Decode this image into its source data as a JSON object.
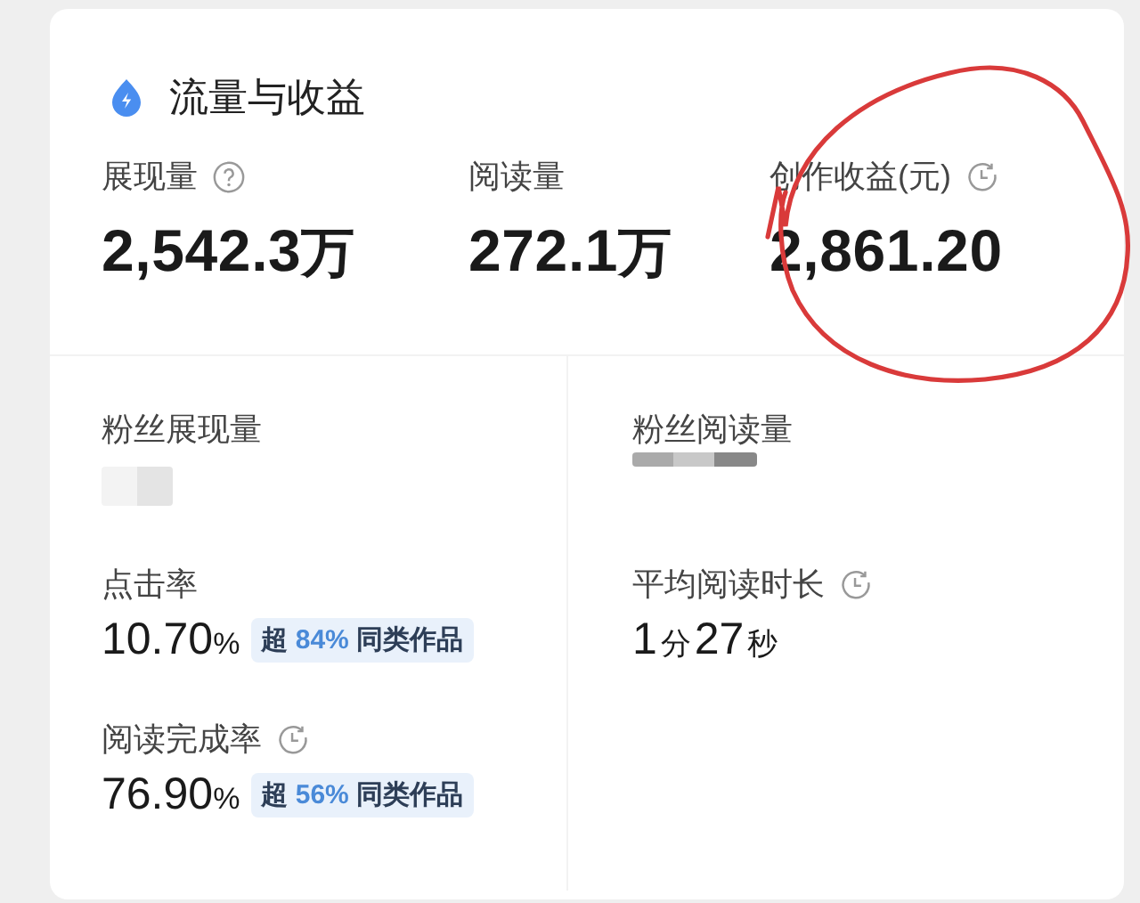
{
  "header": {
    "title": "流量与收益"
  },
  "metrics": [
    {
      "label": "展现量",
      "help": true,
      "clock": false,
      "value": "2,542.3",
      "unit": "万"
    },
    {
      "label": "阅读量",
      "help": false,
      "clock": false,
      "value": "272.1",
      "unit": "万"
    },
    {
      "label": "创作收益(元)",
      "help": false,
      "clock": true,
      "value": "2,861.20"
    }
  ],
  "fans": [
    {
      "label": "粉丝展现量",
      "value_hidden": true
    },
    {
      "label": "粉丝阅读量",
      "value_hidden": true
    }
  ],
  "rates": [
    {
      "label": "点击率",
      "clock": false,
      "value": "10.70",
      "unit": "%",
      "badge": {
        "prefix": "超",
        "percent": "84%",
        "suffix": "同类作品"
      }
    },
    {
      "label": "阅读完成率",
      "clock": true,
      "value": "76.90",
      "unit": "%",
      "badge": {
        "prefix": "超",
        "percent": "56%",
        "suffix": "同类作品"
      }
    }
  ],
  "duration": {
    "label": "平均阅读时长",
    "clock": true,
    "parts": [
      {
        "kind": "number",
        "text": "1"
      },
      {
        "kind": "unit",
        "text": "分"
      },
      {
        "kind": "number",
        "text": "27"
      },
      {
        "kind": "unit",
        "text": "秒"
      }
    ]
  },
  "annotation": {
    "kind": "circle"
  }
}
